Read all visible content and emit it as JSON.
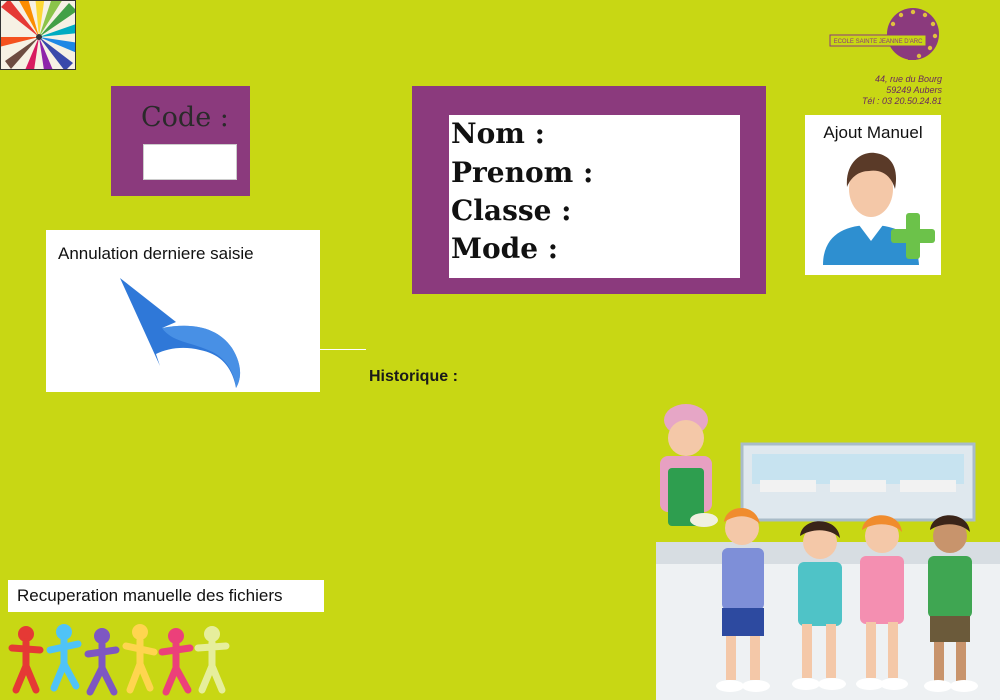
{
  "code": {
    "label": "Code :",
    "value": ""
  },
  "info": {
    "nom_label": "Nom :",
    "prenom_label": "Prenom :",
    "classe_label": "Classe :",
    "mode_label": "Mode :"
  },
  "ajout": {
    "label": "Ajout Manuel"
  },
  "annulation": {
    "label": "Annulation derniere saisie"
  },
  "historique": {
    "label": "Historique :"
  },
  "recuperation": {
    "label": "Recuperation manuelle des fichiers"
  },
  "school": {
    "logo_text": "ECOLE SAINTE JEANNE D'ARC",
    "address_line1": "44, rue du Bourg",
    "address_line2": "59249 Aubers",
    "address_line3": "Tél : 03 20.50.24.81"
  },
  "colors": {
    "background": "#c8d714",
    "panel": "#8b3a7d",
    "undo_arrow": "#2f78d8",
    "plus": "#6cc24a"
  },
  "icons": {
    "logo": "pencils-logo",
    "add_user": "add-user-icon",
    "undo": "undo-arrow-icon",
    "kids": "dancing-kids-illustration",
    "canteen": "canteen-illustration"
  }
}
